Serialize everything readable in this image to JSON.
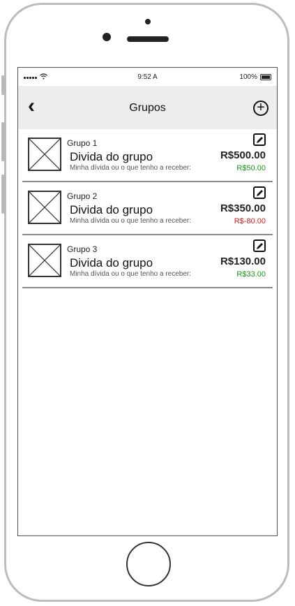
{
  "status_bar": {
    "time": "9:52 A",
    "battery": "100%",
    "wifi_icon": "wifi-icon",
    "signal_icon": "signal-icon"
  },
  "navbar": {
    "title": "Grupos",
    "back_icon": "chevron-left-icon",
    "add_icon": "add-circle-icon"
  },
  "groups": [
    {
      "name": "Grupo 1",
      "description": "Divida do grupo",
      "total": "R$500.00",
      "sub_label": "Minha dívida ou o que tenho a receber:",
      "mine": "R$50.00",
      "mine_color": "#1a9a1a"
    },
    {
      "name": "Grupo 2",
      "description": "Divida do grupo",
      "total": "R$350.00",
      "sub_label": "Minha dívida ou o que tenho a receber:",
      "mine": "R$-80.00",
      "mine_color": "#d01e1e"
    },
    {
      "name": "Grupo 3",
      "description": "Divida do grupo",
      "total": "R$130.00",
      "sub_label": "Minha dívida ou o que tenho a receber:",
      "mine": "R$33.00",
      "mine_color": "#1a9a1a"
    }
  ]
}
